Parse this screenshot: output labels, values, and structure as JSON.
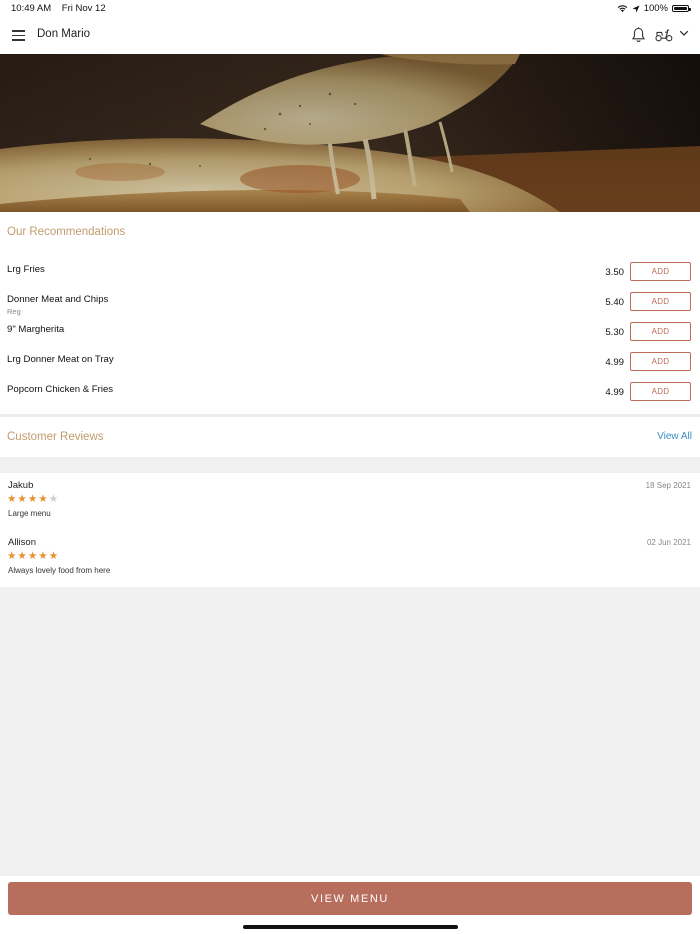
{
  "status_bar": {
    "time": "10:49 AM",
    "date": "Fri Nov 12",
    "battery": "100%",
    "battery_level": 1.0
  },
  "header": {
    "title": "Don Mario"
  },
  "recommendations": {
    "title": "Our Recommendations",
    "items": [
      {
        "name": "Lrg Fries",
        "sub": "",
        "price": "3.50",
        "action": "ADD"
      },
      {
        "name": "Donner Meat and Chips",
        "sub": "Reg",
        "price": "5.40",
        "action": "ADD"
      },
      {
        "name": "9\" Margherita",
        "sub": "",
        "price": "5.30",
        "action": "ADD"
      },
      {
        "name": "Lrg Donner Meat on Tray",
        "sub": "",
        "price": "4.99",
        "action": "ADD"
      },
      {
        "name": "Popcorn Chicken & Fries",
        "sub": "",
        "price": "4.99",
        "action": "ADD"
      }
    ]
  },
  "reviews": {
    "title": "Customer Reviews",
    "view_all": "View All",
    "items": [
      {
        "name": "Jakub",
        "date": "18 Sep 2021",
        "rating": 4,
        "max_rating": 5,
        "text": "Large menu"
      },
      {
        "name": "Allison",
        "date": "02 Jun 2021",
        "rating": 5,
        "max_rating": 5,
        "text": "Always lovely food from here"
      }
    ]
  },
  "footer": {
    "view_menu": "VIEW MENU"
  },
  "colors": {
    "accent": "#b86e5d",
    "section_title": "#c29b6e",
    "link": "#3c8ec0",
    "star_on": "#e8902e",
    "star_off": "#cccccc"
  },
  "icons": [
    "menu-icon",
    "bell-icon",
    "delivery-scooter-icon",
    "chevron-down-icon",
    "wifi-icon",
    "location-arrow-icon",
    "battery-icon",
    "star-icon"
  ]
}
